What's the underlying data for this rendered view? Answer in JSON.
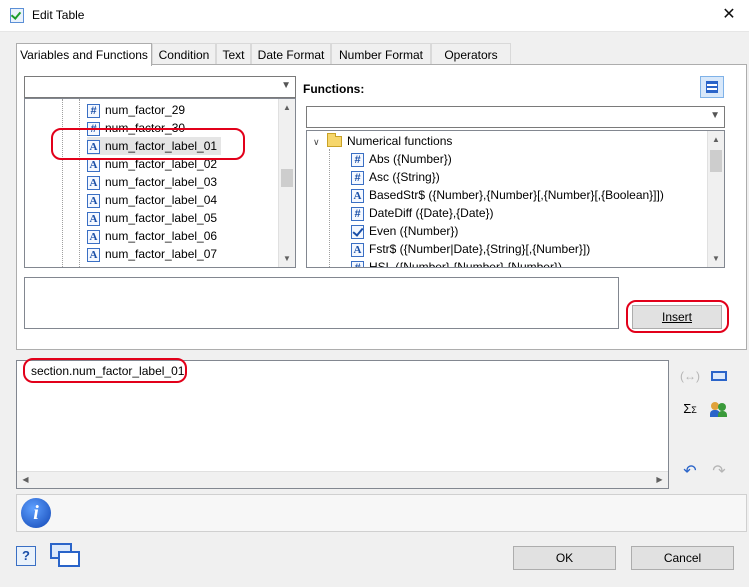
{
  "window": {
    "title": "Edit Table",
    "close_glyph": "✕"
  },
  "tabs": [
    {
      "label": "Variables and Functions",
      "active": true
    },
    {
      "label": "Condition"
    },
    {
      "label": "Text"
    },
    {
      "label": "Date Format"
    },
    {
      "label": "Number Format"
    },
    {
      "label": "Operators"
    }
  ],
  "variables": {
    "combo_value": "",
    "items": [
      {
        "label": "num_factor_29",
        "icon": "number-icon"
      },
      {
        "label": "num_factor_30",
        "icon": "number-icon"
      },
      {
        "label": "num_factor_label_01",
        "icon": "text-icon",
        "selected": true
      },
      {
        "label": "num_factor_label_02",
        "icon": "text-icon"
      },
      {
        "label": "num_factor_label_03",
        "icon": "text-icon"
      },
      {
        "label": "num_factor_label_04",
        "icon": "text-icon"
      },
      {
        "label": "num_factor_label_05",
        "icon": "text-icon"
      },
      {
        "label": "num_factor_label_06",
        "icon": "text-icon"
      },
      {
        "label": "num_factor_label_07",
        "icon": "text-icon"
      }
    ]
  },
  "functions": {
    "label": "Functions:",
    "combo_value": "",
    "group": "Numerical functions",
    "items": [
      {
        "label": "Abs ({Number})",
        "icon": "number-icon"
      },
      {
        "label": "Asc ({String})",
        "icon": "number-icon"
      },
      {
        "label": "BasedStr$ ({Number},{Number}[,{Number}[,{Boolean}]])",
        "icon": "text-icon"
      },
      {
        "label": "DateDiff ({Date},{Date})",
        "icon": "number-icon"
      },
      {
        "label": "Even ({Number})",
        "icon": "boolean-icon"
      },
      {
        "label": "Fstr$ ({Number|Date},{String}[,{Number}])",
        "icon": "text-icon"
      },
      {
        "label": "HSL ({Number},{Number},{Number})",
        "icon": "number-icon"
      }
    ]
  },
  "description": "",
  "insert_label": "Insert",
  "expression": "section.num_factor_label_01",
  "buttons": {
    "ok": "OK",
    "cancel": "Cancel"
  },
  "icons": {
    "help": "?",
    "info": "i",
    "sigma": "Σ",
    "undo": "↶",
    "redo": "↷"
  },
  "colors": {
    "highlight_ring": "#e2001a",
    "accent_blue": "#1a4fa8"
  }
}
